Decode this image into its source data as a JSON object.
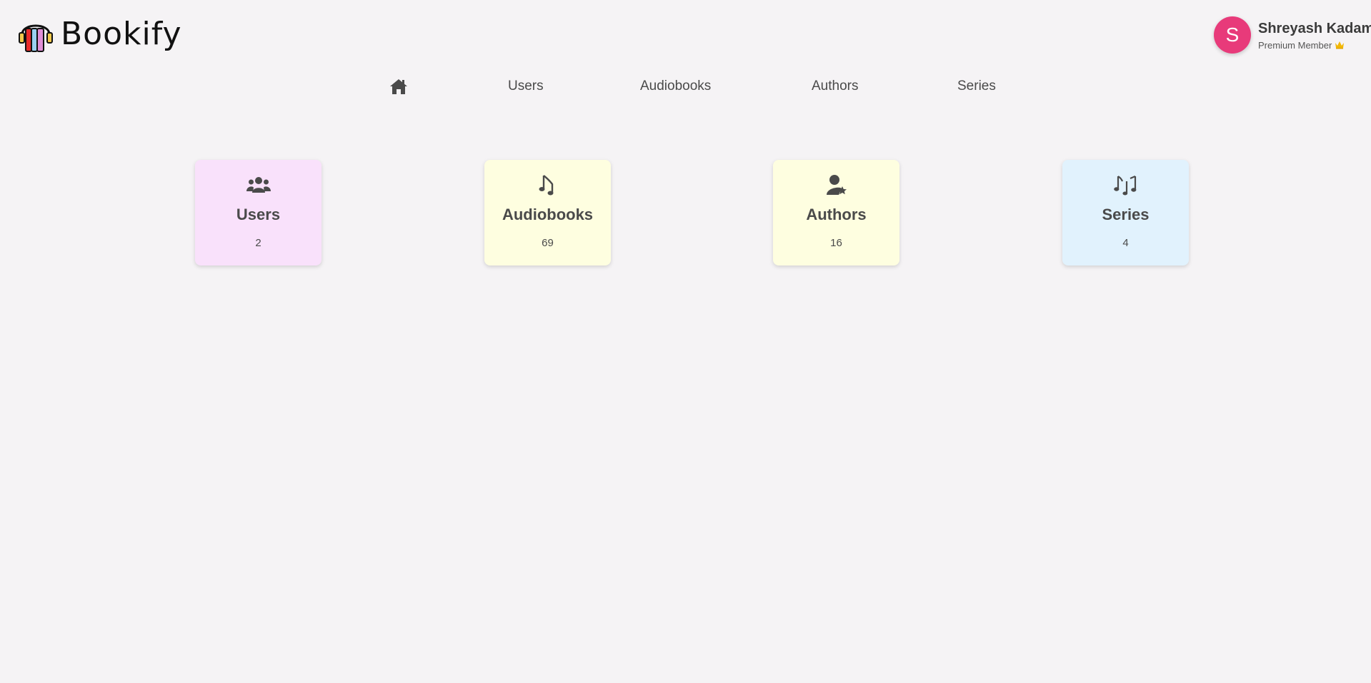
{
  "app": {
    "logo_text": "Bookify"
  },
  "user": {
    "avatar_initial": "S",
    "name": "Shreyash Kadam",
    "tier": "Premium Member",
    "tier_icon": "crown-icon"
  },
  "nav": {
    "home_icon": "home-icon",
    "items": [
      {
        "label": "Users"
      },
      {
        "label": "Audiobooks"
      },
      {
        "label": "Authors"
      },
      {
        "label": "Series"
      }
    ]
  },
  "cards": [
    {
      "title": "Users",
      "count": "2",
      "icon": "users-icon",
      "color": "#f9e1fb"
    },
    {
      "title": "Audiobooks",
      "count": "69",
      "icon": "music-note-icon",
      "color": "#fefee0"
    },
    {
      "title": "Authors",
      "count": "16",
      "icon": "user-star-icon",
      "color": "#fefee0"
    },
    {
      "title": "Series",
      "count": "4",
      "icon": "music-notes-icon",
      "color": "#e1f2fd"
    }
  ],
  "colors": {
    "background": "#f5f3f5",
    "avatar": "#e83a7a",
    "text": "#4a4a4a",
    "crown": "#f2b705"
  }
}
